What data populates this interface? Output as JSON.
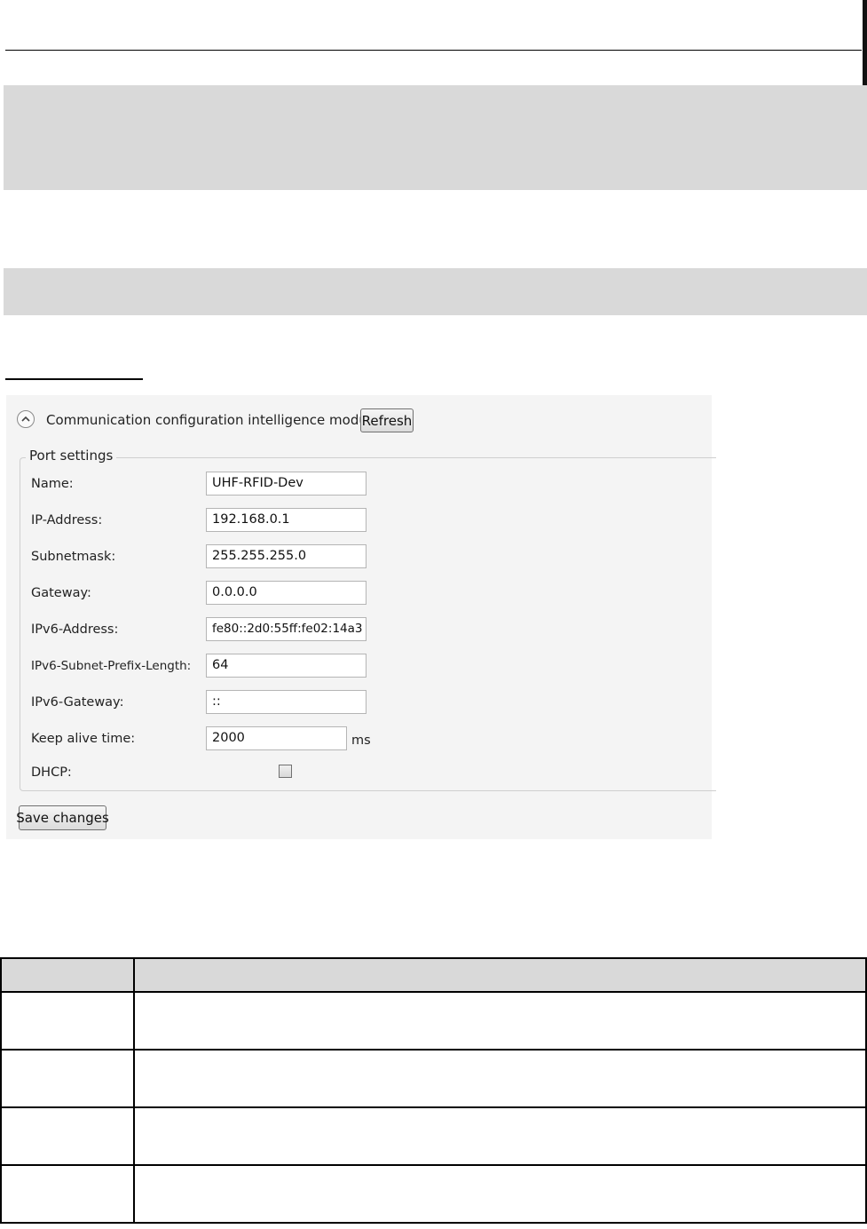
{
  "panel": {
    "title": "Communication configuration intelligence module",
    "refresh_label": "Refresh",
    "collapse_icon": "chevron-up-icon",
    "group_label": "Port settings",
    "fields": [
      {
        "label": "Name:",
        "value": "UHF-RFID-Dev"
      },
      {
        "label": "IP-Address:",
        "value": "192.168.0.1"
      },
      {
        "label": "Subnetmask:",
        "value": "255.255.255.0"
      },
      {
        "label": "Gateway:",
        "value": "0.0.0.0"
      },
      {
        "label": "IPv6-Address:",
        "value": "fe80::2d0:55ff:fe02:14a3"
      },
      {
        "label": "IPv6-Subnet-Prefix-Length:",
        "value": "64"
      },
      {
        "label": "IPv6-Gateway:",
        "value": "::"
      },
      {
        "label": "Keep alive time:",
        "value": "2000"
      }
    ],
    "keep_alive_unit": "ms",
    "dhcp_label": "DHCP:",
    "dhcp_checked": false,
    "save_label": "Save changes"
  },
  "colors": {
    "band": "#d9d9d9",
    "panel_bg": "#f4f4f4"
  }
}
